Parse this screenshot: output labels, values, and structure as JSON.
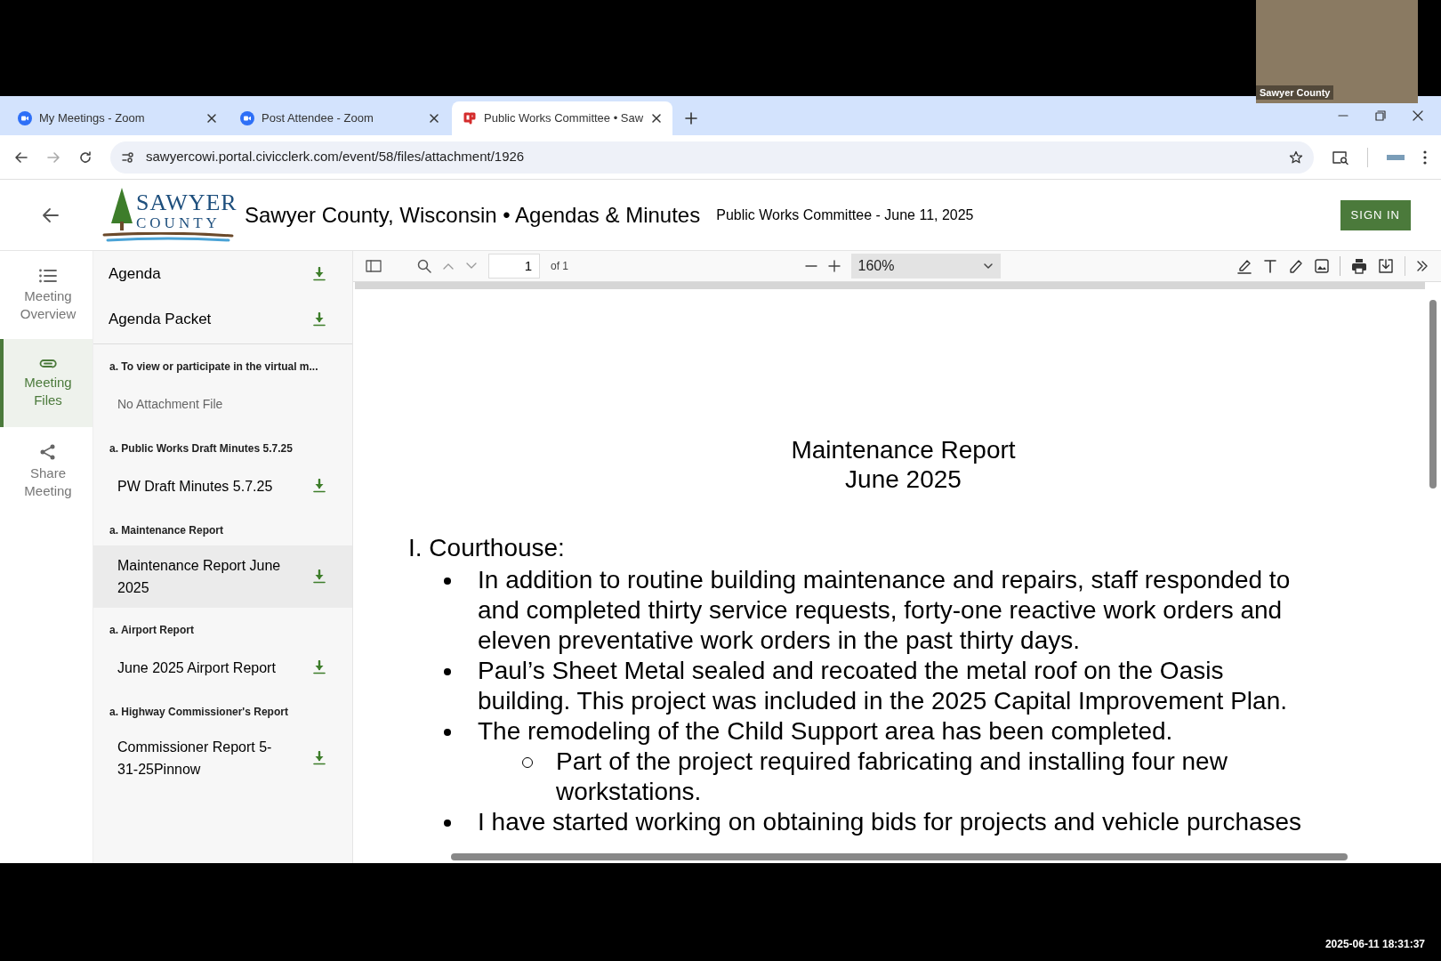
{
  "video_tile": {
    "label": "Sawyer County"
  },
  "browser": {
    "tabs": [
      {
        "title": "My Meetings - Zoom",
        "kind": "zoom",
        "selected": false
      },
      {
        "title": "Post Attendee - Zoom",
        "kind": "zoom",
        "selected": false
      },
      {
        "title": "Public Works Committee • Saw",
        "kind": "civic",
        "selected": true
      }
    ],
    "url": "sawyercowi.portal.civicclerk.com/event/58/files/attachment/1926"
  },
  "header": {
    "logo": {
      "line1": "SAWYER",
      "line2": "COUNTY"
    },
    "site_title": "Sawyer County, Wisconsin • Agendas & Minutes",
    "meeting_title": "Public Works Committee - June 11, 2025",
    "sign_in": "SIGN IN"
  },
  "nav": [
    {
      "label": "Meeting Overview",
      "kind": "list",
      "selected": false
    },
    {
      "label": "Meeting Files",
      "kind": "clip",
      "selected": true
    },
    {
      "label": "Share Meeting",
      "kind": "share",
      "selected": false
    }
  ],
  "files": {
    "top": [
      {
        "label": "Agenda"
      },
      {
        "label": "Agenda Packet"
      }
    ],
    "sections": [
      {
        "heading": "a. To view or participate in the virtual m...",
        "items": [
          {
            "label": "No Attachment File",
            "kind": "none",
            "selected": false
          }
        ]
      },
      {
        "heading": "a. Public Works Draft Minutes 5.7.25",
        "items": [
          {
            "label": "PW Draft Minutes 5.7.25",
            "kind": "file",
            "selected": false
          }
        ]
      },
      {
        "heading": "a. Maintenance Report",
        "items": [
          {
            "label": "Maintenance Report June 2025",
            "kind": "file",
            "selected": true
          }
        ]
      },
      {
        "heading": "a. Airport Report",
        "items": [
          {
            "label": "June 2025 Airport Report",
            "kind": "file",
            "selected": false
          }
        ]
      },
      {
        "heading": "a. Highway Commissioner's Report",
        "items": [
          {
            "label": "Commissioner Report 5-31-25Pinnow",
            "kind": "file",
            "selected": false
          }
        ]
      }
    ]
  },
  "pdf_toolbar": {
    "page": "1",
    "page_count": "of 1",
    "zoom": "160%"
  },
  "document": {
    "title": [
      "Maintenance Report",
      "June 2025"
    ],
    "sections": [
      {
        "heading": "I. Courthouse:",
        "bullets": [
          {
            "text": "In addition to routine building maintenance and repairs, staff responded to and completed thirty service requests, forty-one reactive work orders and eleven preventative work orders in the past thirty days."
          },
          {
            "text": "Paul’s Sheet Metal sealed and recoated the metal roof on the Oasis building. This project was included in the 2025 Capital Improvement Plan."
          },
          {
            "text": "The remodeling of the Child Support area has been completed.",
            "children": [
              {
                "text": "Part of the project required fabricating and installing four new workstations."
              }
            ]
          },
          {
            "text": "I have started working on obtaining bids for projects and vehicle purchases"
          }
        ]
      }
    ]
  },
  "timestamp": "2025-06-11 18:31:37"
}
